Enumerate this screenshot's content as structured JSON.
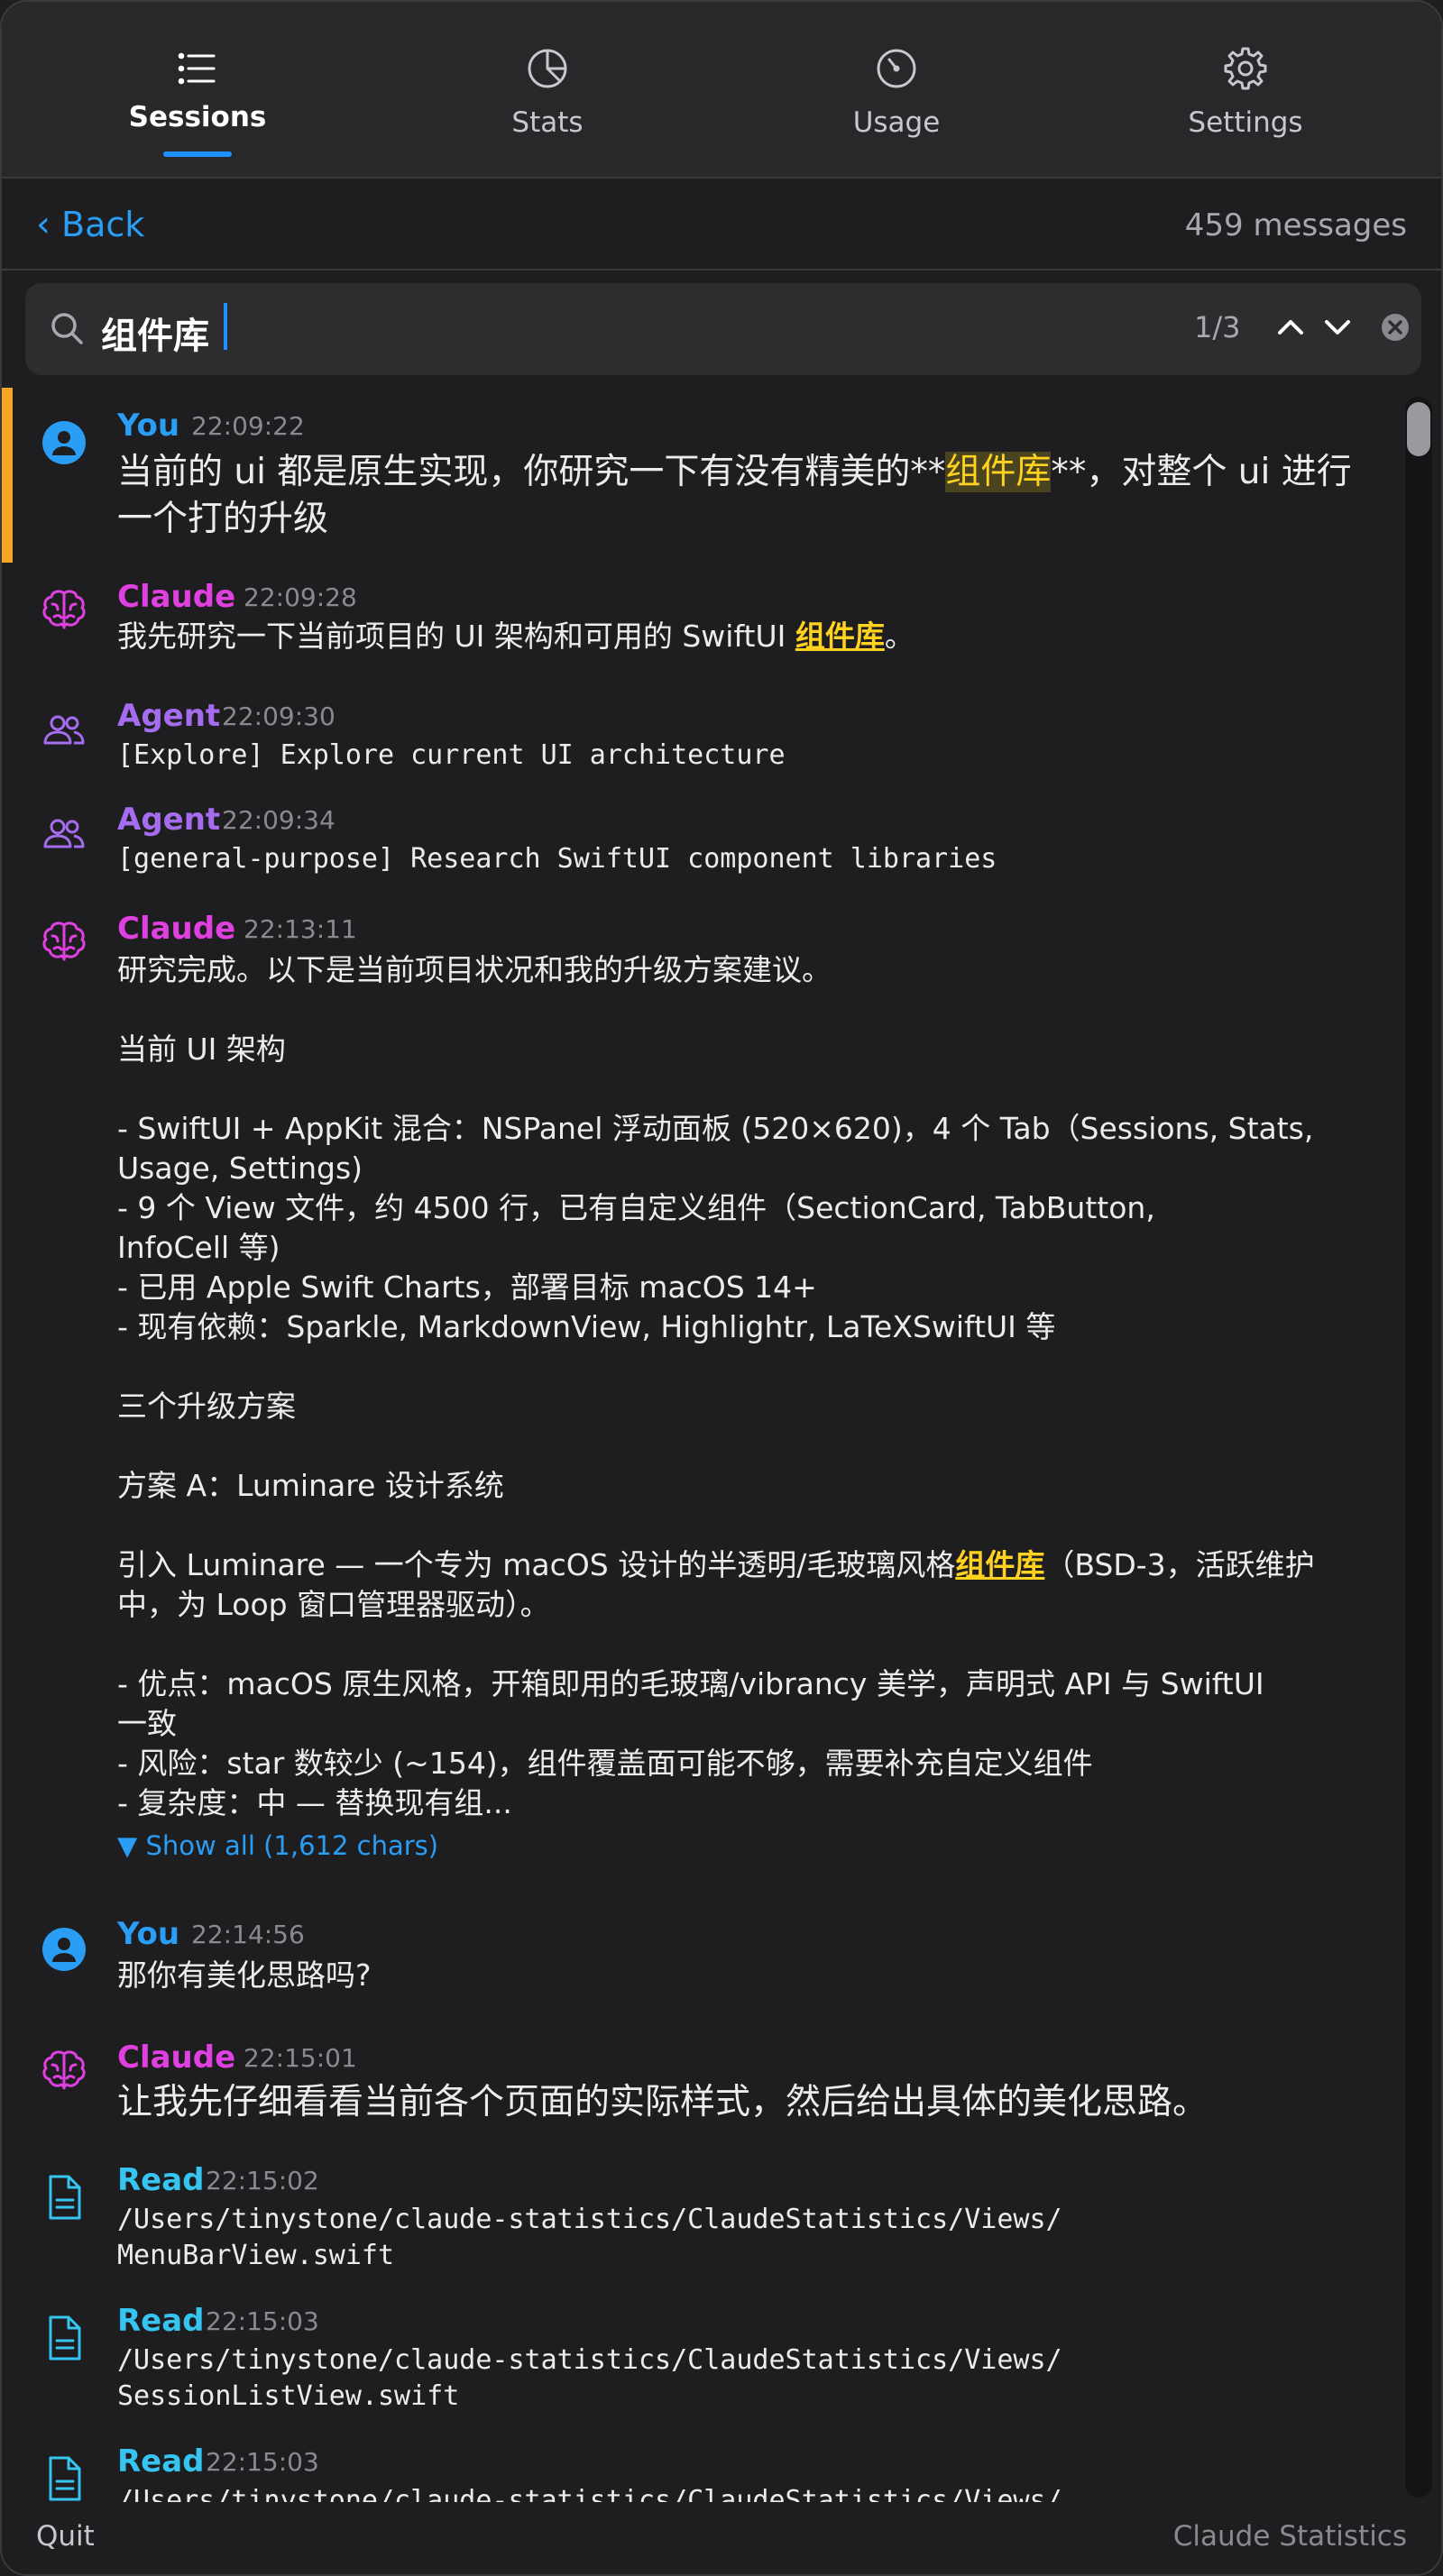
{
  "tabs": [
    {
      "label": "Sessions",
      "icon": "list-icon",
      "active": true
    },
    {
      "label": "Stats",
      "icon": "pie-chart-icon"
    },
    {
      "label": "Usage",
      "icon": "gauge-icon"
    },
    {
      "label": "Settings",
      "icon": "gear-icon"
    }
  ],
  "nav": {
    "back_label": "Back",
    "message_count": "459 messages"
  },
  "search": {
    "query": "组件库",
    "counter": "1/3"
  },
  "colors": {
    "accent": "#1e90ff",
    "you": "#2a9df4",
    "claude": "#e040e0",
    "agent": "#a66cf0",
    "read": "#36c4f0",
    "highlight": "#ffd21f",
    "selection": "#f5a623"
  },
  "messages": {
    "m1": {
      "role": "You",
      "time": "22:09:22",
      "pre": "当前的 ui 都是原生实现，你研究一下有没有精美的**",
      "match": "组件库",
      "post": "**，对整个 ui 进行一个打的升级"
    },
    "m2": {
      "role": "Claude",
      "time": "22:09:28",
      "pre": "我先研究一下当前项目的 UI 架构和可用的 SwiftUI ",
      "match": "组件库",
      "post": "。"
    },
    "m3": {
      "role": "Agent",
      "time": "22:09:30",
      "text": "[Explore] Explore current UI architecture"
    },
    "m4": {
      "role": "Agent",
      "time": "22:09:34",
      "text": "[general-purpose] Research SwiftUI component libraries"
    },
    "m5": {
      "role": "Claude",
      "time": "22:13:11",
      "l1": "研究完成。以下是当前项目状况和我的升级方案建议。",
      "l2": "当前 UI 架构",
      "l3": "- SwiftUI + AppKit 混合：NSPanel 浮动面板 (520×620)，4 个 Tab（Sessions, Stats,",
      "l4": "Usage, Settings)",
      "l5": "- 9 个 View 文件，约 4500 行，已有自定义组件（SectionCard, TabButton,",
      "l6": "InfoCell 等)",
      "l7": "- 已用 Apple Swift Charts，部署目标 macOS 14+",
      "l8": "- 现有依赖：Sparkle, MarkdownView, Highlightr, LaTeXSwiftUI 等",
      "l9": "三个升级方案",
      "l10": "方案 A：Luminare 设计系统",
      "l11_pre": "引入 Luminare — 一个专为 macOS 设计的半透明/毛玻璃风格",
      "l11_match": "组件库",
      "l11_post": "（BSD-3，活跃维护",
      "l12": "中，为 Loop 窗口管理器驱动）。",
      "l13": "- 优点：macOS 原生风格，开箱即用的毛玻璃/vibrancy 美学，声明式 API 与 SwiftUI",
      "l14": "一致",
      "l15": "- 风险：star 数较少 (~154)，组件覆盖面可能不够，需要补充自定义组件",
      "l16": "- 复杂度：中 — 替换现有组...",
      "show_all": "▼ Show all (1,612 chars)"
    },
    "m6": {
      "role": "You",
      "time": "22:14:56",
      "text": "那你有美化思路吗?"
    },
    "m7": {
      "role": "Claude",
      "time": "22:15:01",
      "text": "让我先仔细看看当前各个页面的实际样式，然后给出具体的美化思路。"
    },
    "m8": {
      "role": "Read",
      "time": "22:15:02",
      "l1": "/Users/tinystone/claude-statistics/ClaudeStatistics/Views/",
      "l2": "MenuBarView.swift"
    },
    "m9": {
      "role": "Read",
      "time": "22:15:03",
      "l1": "/Users/tinystone/claude-statistics/ClaudeStatistics/Views/",
      "l2": "SessionListView.swift"
    },
    "m10": {
      "role": "Read",
      "time": "22:15:03",
      "l1": "/Users/tinystone/claude-statistics/ClaudeStatistics/Views/"
    }
  },
  "footer": {
    "quit_label": "Quit",
    "app_name": "Claude Statistics"
  }
}
